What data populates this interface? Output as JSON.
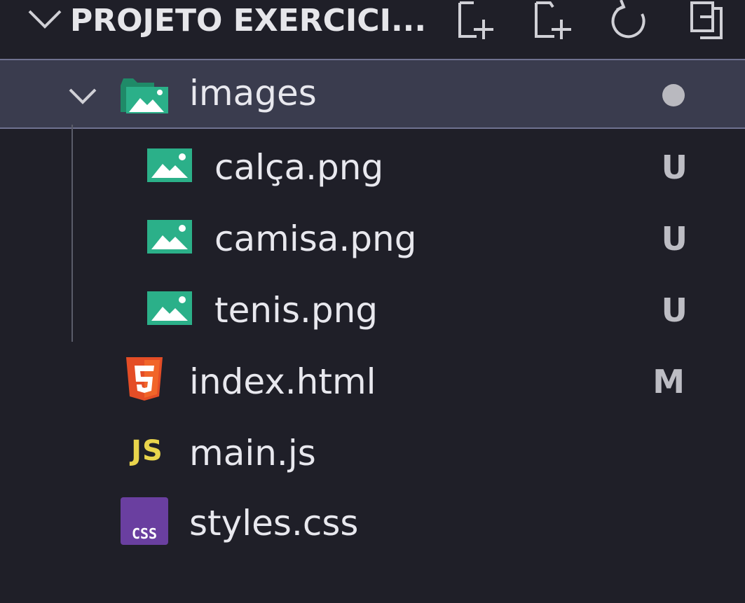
{
  "explorer": {
    "title": "PROJETO EXERCICI...",
    "actions": [
      {
        "icon": "new-file-icon"
      },
      {
        "icon": "new-folder-icon"
      },
      {
        "icon": "refresh-icon"
      },
      {
        "icon": "collapse-all-icon"
      }
    ],
    "tree": {
      "folder": {
        "name": "images",
        "icon": "image-folder-icon",
        "expanded": true,
        "status": "dot"
      },
      "children": [
        {
          "name": "calça.png",
          "icon": "image-file-icon",
          "status": "U"
        },
        {
          "name": "camisa.png",
          "icon": "image-file-icon",
          "status": "U"
        },
        {
          "name": "tenis.png",
          "icon": "image-file-icon",
          "status": "U"
        }
      ],
      "files": [
        {
          "name": "index.html",
          "icon": "html5-icon",
          "status": "M"
        },
        {
          "name": "main.js",
          "icon": "js-icon",
          "icon_text": "JS",
          "status": ""
        },
        {
          "name": "styles.css",
          "icon": "css-icon",
          "icon_text": "CSS",
          "status": ""
        }
      ]
    },
    "colors": {
      "background": "#1f1f28",
      "selected": "#3a3c4e",
      "image_green": "#2bb089",
      "html_orange": "#e44d26",
      "js_yellow": "#e9d44c",
      "css_purple": "#6a3fa0"
    }
  }
}
